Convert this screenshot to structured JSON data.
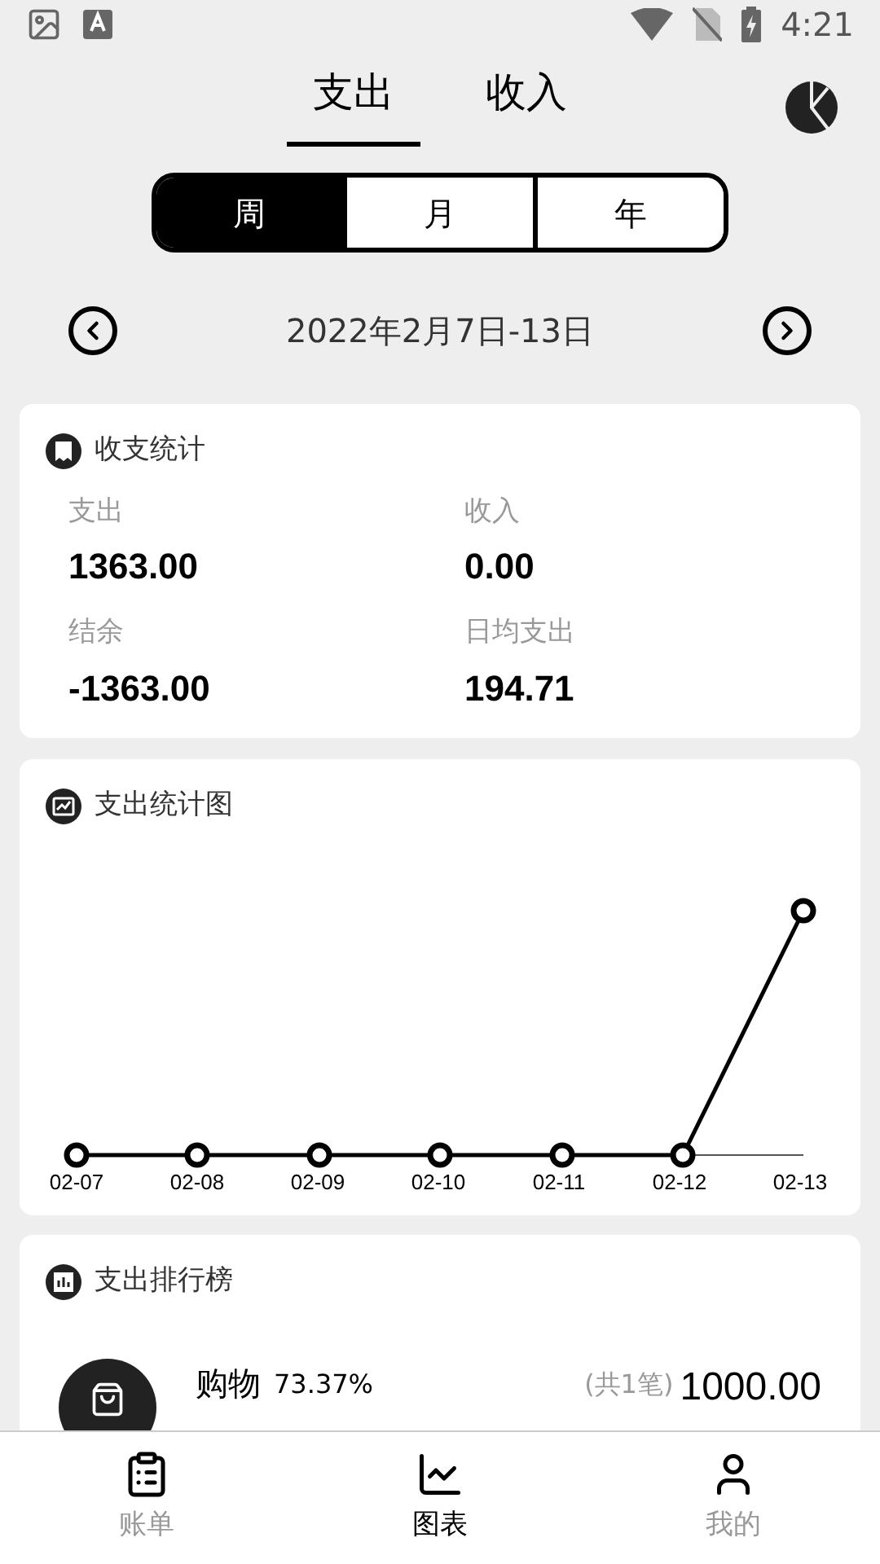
{
  "status_bar": {
    "time": "4:21"
  },
  "type_tabs": [
    {
      "label": "支出",
      "selected": true
    },
    {
      "label": "收入",
      "selected": false
    }
  ],
  "period_tabs": [
    {
      "label": "周",
      "selected": true
    },
    {
      "label": "月",
      "selected": false
    },
    {
      "label": "年",
      "selected": false
    }
  ],
  "date_range": "2022年2月7日-13日",
  "summary": {
    "title": "收支统计",
    "items": [
      {
        "label": "支出",
        "value": "1363.00"
      },
      {
        "label": "收入",
        "value": "0.00"
      },
      {
        "label": "结余",
        "value": "-1363.00"
      },
      {
        "label": "日均支出",
        "value": "194.71"
      }
    ]
  },
  "trend": {
    "title": "支出统计图",
    "x_labels": [
      "02-07",
      "02-08",
      "02-09",
      "02-10",
      "02-11",
      "02-12",
      "02-13"
    ]
  },
  "ranking": {
    "title": "支出排行榜",
    "rows": [
      {
        "category": "购物",
        "percent": "73.37%",
        "count": "(共1笔)",
        "amount": "1000.00"
      }
    ]
  },
  "nav": [
    {
      "label": "账单",
      "selected": false,
      "kind": "bill"
    },
    {
      "label": "图表",
      "selected": true,
      "kind": "chart"
    },
    {
      "label": "我的",
      "selected": false,
      "kind": "user"
    }
  ]
}
